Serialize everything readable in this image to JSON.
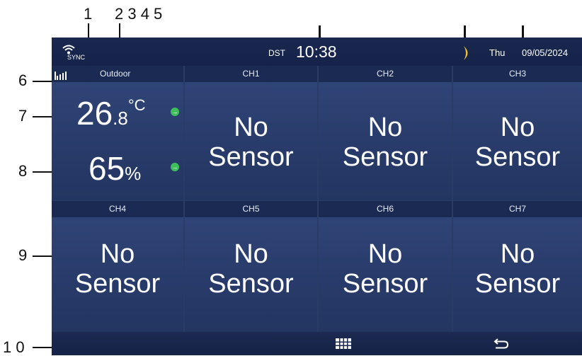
{
  "callouts": {
    "n1": "1",
    "n2345": "2 3 4 5",
    "n6": "6",
    "n7": "7",
    "n8": "8",
    "n9": "9",
    "n10": "1 0"
  },
  "status_bar": {
    "sync_label": "SYNC",
    "dst_label": "DST",
    "time": "10:38",
    "day": "Thu",
    "date": "09/05/2024"
  },
  "outdoor": {
    "label": "Outdoor",
    "temp_int": "26",
    "temp_dec": ".8",
    "temp_unit": "°C",
    "humidity": "65",
    "humidity_unit": "%",
    "trend_temp": "→",
    "trend_hum": "→"
  },
  "channels": [
    {
      "label": "CH1",
      "status_line1": "No",
      "status_line2": "Sensor"
    },
    {
      "label": "CH2",
      "status_line1": "No",
      "status_line2": "Sensor"
    },
    {
      "label": "CH3",
      "status_line1": "No",
      "status_line2": "Sensor"
    },
    {
      "label": "CH4",
      "status_line1": "No",
      "status_line2": "Sensor"
    },
    {
      "label": "CH5",
      "status_line1": "No",
      "status_line2": "Sensor"
    },
    {
      "label": "CH6",
      "status_line1": "No",
      "status_line2": "Sensor"
    },
    {
      "label": "CH7",
      "status_line1": "No",
      "status_line2": "Sensor"
    }
  ],
  "icons": {
    "wifi": "wifi-icon",
    "signal": "signal-bars-icon",
    "moon": "moon-icon",
    "grid": "grid-menu-icon",
    "back": "back-arrow-icon"
  },
  "colors": {
    "screen_bg": "#2a3b66",
    "bar_bg": "#15224a",
    "moon": "#f2c230",
    "trend": "#3fbf5a"
  }
}
